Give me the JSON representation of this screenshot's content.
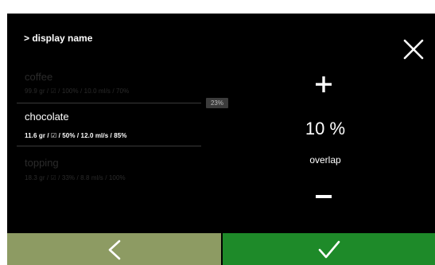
{
  "header": {
    "title": "> display name",
    "close_icon": "close-icon"
  },
  "ingredients": [
    {
      "name": "coffee",
      "detail": "99.9 gr / ☑ / 100% / 10.0 ml/s / 70%",
      "selected": false
    },
    {
      "name": "chocolate",
      "detail": "11.6 gr / ☑ / 50% / 12.0 ml/s / 85%",
      "selected": true
    },
    {
      "name": "topping",
      "detail": "18.3 gr / ☑ / 33% / 8.8 ml/s / 100%",
      "selected": false
    }
  ],
  "overlap_badge": "23%",
  "control": {
    "increase_icon": "plus-icon",
    "value": "10 %",
    "label": "overlap",
    "decrease_icon": "minus-icon"
  },
  "footer": {
    "back_icon": "chevron-left-icon",
    "confirm_icon": "check-icon"
  },
  "colors": {
    "background": "#000000",
    "back_button": "#8d9b63",
    "confirm_button": "#1e8a29",
    "dim_text": "#2b2b2b"
  }
}
